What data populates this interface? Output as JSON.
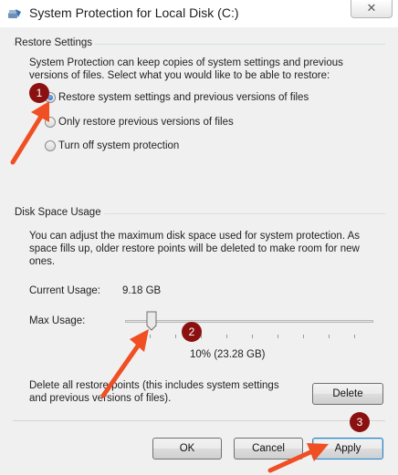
{
  "window": {
    "title": "System Protection for Local Disk (C:)",
    "close_glyph": "✕"
  },
  "restore": {
    "legend": "Restore Settings",
    "description": "System Protection can keep copies of system settings and previous versions of files. Select what you would like to be able to restore:",
    "options": [
      {
        "label": "Restore system settings and previous versions of files",
        "selected": true
      },
      {
        "label": "Only restore previous versions of files",
        "selected": false
      },
      {
        "label": "Turn off system protection",
        "selected": false
      }
    ]
  },
  "disk": {
    "legend": "Disk Space Usage",
    "description": "You can adjust the maximum disk space used for system protection. As space fills up, older restore points will be deleted to make room for new ones.",
    "current_label": "Current Usage:",
    "current_value": "9.18 GB",
    "max_label": "Max Usage:",
    "max_fraction": 0.1,
    "max_value_text": "10% (23.28 GB)",
    "delete_text": "Delete all restore points (this includes system settings and previous versions of files).",
    "delete_label": "Delete"
  },
  "footer": {
    "ok_label": "OK",
    "cancel_label": "Cancel",
    "apply_label": "Apply"
  },
  "annotations": {
    "badge_1": "1",
    "badge_2": "2",
    "badge_3": "3",
    "color": "#8b1010",
    "arrow_color": "#f04e23"
  }
}
